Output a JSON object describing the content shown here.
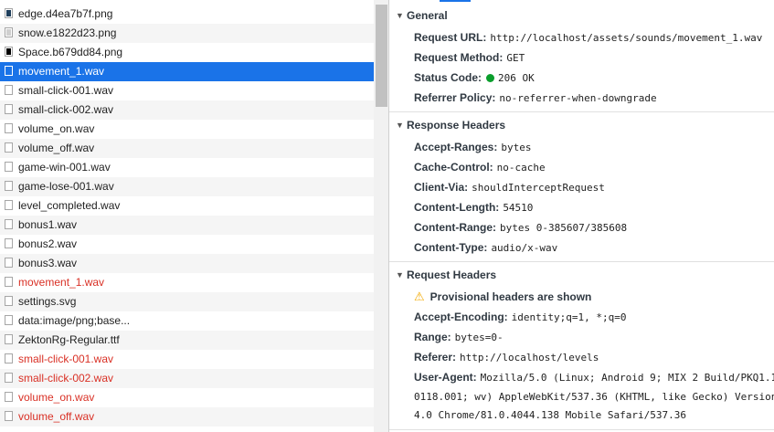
{
  "request_list": [
    {
      "name": "edge.d4ea7b7f.png",
      "icon": "image-dark-file-icon",
      "status": "normal"
    },
    {
      "name": "snow.e1822d23.png",
      "icon": "image-light-file-icon",
      "status": "normal"
    },
    {
      "name": "Space.b679dd84.png",
      "icon": "image-black-file-icon",
      "status": "normal"
    },
    {
      "name": "movement_1.wav",
      "icon": "file-icon",
      "status": "selected"
    },
    {
      "name": "small-click-001.wav",
      "icon": "file-icon",
      "status": "normal"
    },
    {
      "name": "small-click-002.wav",
      "icon": "file-icon",
      "status": "normal"
    },
    {
      "name": "volume_on.wav",
      "icon": "file-icon",
      "status": "normal"
    },
    {
      "name": "volume_off.wav",
      "icon": "file-icon",
      "status": "normal"
    },
    {
      "name": "game-win-001.wav",
      "icon": "file-icon",
      "status": "normal"
    },
    {
      "name": "game-lose-001.wav",
      "icon": "file-icon",
      "status": "normal"
    },
    {
      "name": "level_completed.wav",
      "icon": "file-icon",
      "status": "normal"
    },
    {
      "name": "bonus1.wav",
      "icon": "file-icon",
      "status": "normal"
    },
    {
      "name": "bonus2.wav",
      "icon": "file-icon",
      "status": "normal"
    },
    {
      "name": "bonus3.wav",
      "icon": "file-icon",
      "status": "normal"
    },
    {
      "name": "movement_1.wav",
      "icon": "file-icon",
      "status": "error"
    },
    {
      "name": "settings.svg",
      "icon": "file-icon",
      "status": "normal"
    },
    {
      "name": "data:image/png;base...",
      "icon": "file-icon",
      "status": "normal"
    },
    {
      "name": "ZektonRg-Regular.ttf",
      "icon": "file-icon",
      "status": "normal"
    },
    {
      "name": "small-click-001.wav",
      "icon": "file-icon",
      "status": "error"
    },
    {
      "name": "small-click-002.wav",
      "icon": "file-icon",
      "status": "error"
    },
    {
      "name": "volume_on.wav",
      "icon": "file-icon",
      "status": "error"
    },
    {
      "name": "volume_off.wav",
      "icon": "file-icon",
      "status": "error"
    }
  ],
  "general": {
    "title": "General",
    "request_url_key": "Request URL:",
    "request_url": "http://localhost/assets/sounds/movement_1.wav",
    "request_method_key": "Request Method:",
    "request_method": "GET",
    "status_code_key": "Status Code:",
    "status_code": "206 OK",
    "referrer_policy_key": "Referrer Policy:",
    "referrer_policy": "no-referrer-when-downgrade"
  },
  "response_headers": {
    "title": "Response Headers",
    "accept_ranges_key": "Accept-Ranges:",
    "accept_ranges": "bytes",
    "cache_control_key": "Cache-Control:",
    "cache_control": "no-cache",
    "client_via_key": "Client-Via:",
    "client_via": "shouldInterceptRequest",
    "content_length_key": "Content-Length:",
    "content_length": "54510",
    "content_range_key": "Content-Range:",
    "content_range": "bytes 0-385607/385608",
    "content_type_key": "Content-Type:",
    "content_type": "audio/x-wav"
  },
  "request_headers": {
    "title": "Request Headers",
    "provisional_warning": "Provisional headers are shown",
    "accept_encoding_key": "Accept-Encoding:",
    "accept_encoding": "identity;q=1, *;q=0",
    "range_key": "Range:",
    "range": "bytes=0-",
    "referer_key": "Referer:",
    "referer": "http://localhost/levels",
    "user_agent_key": "User-Agent:",
    "user_agent_line1": "Mozilla/5.0 (Linux; Android 9; MIX 2 Build/PKQ1.1",
    "user_agent_line2": "0118.001; wv) AppleWebKit/537.36 (KHTML, like Gecko) Version",
    "user_agent_line3": "4.0 Chrome/81.0.4044.138 Mobile Safari/537.36"
  },
  "colors": {
    "selected_row": "#1a73e8",
    "error_text": "#d93025",
    "status_ok_dot": "#0a9e2c",
    "warning_icon": "#f2a900"
  }
}
